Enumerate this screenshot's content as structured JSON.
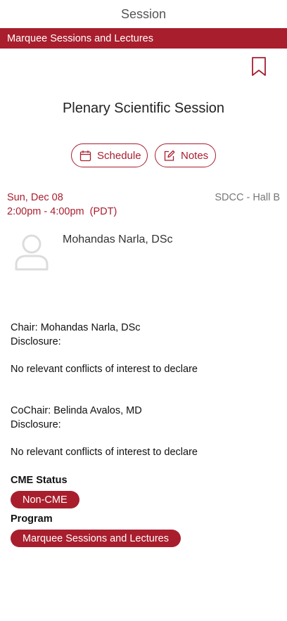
{
  "header": {
    "title": "Session"
  },
  "banner": {
    "label": "Marquee Sessions and Lectures"
  },
  "session": {
    "title": "Plenary Scientific Session",
    "date": "Sun, Dec 08",
    "time": "2:00pm - 4:00pm  (PDT)",
    "location": "SDCC - Hall B"
  },
  "actions": {
    "schedule_label": "Schedule",
    "notes_label": "Notes"
  },
  "speaker": {
    "name": "Mohandas Narla, DSc"
  },
  "chair": {
    "line": "Chair: Mohandas Narla, DSc",
    "disclosure_label": "Disclosure:",
    "disclosure_text": "No relevant conflicts of interest to declare"
  },
  "cochair": {
    "line": "CoChair: Belinda Avalos, MD",
    "disclosure_label": "Disclosure:",
    "disclosure_text": "No relevant conflicts of interest to declare"
  },
  "cme": {
    "label": "CME Status",
    "value": "Non-CME"
  },
  "program": {
    "label": "Program",
    "value": "Marquee Sessions and Lectures"
  },
  "colors": {
    "accent": "#a81e2d"
  },
  "icons": {
    "bookmark": "bookmark-icon",
    "calendar": "calendar-icon",
    "notes": "edit-icon",
    "avatar": "person-icon"
  }
}
